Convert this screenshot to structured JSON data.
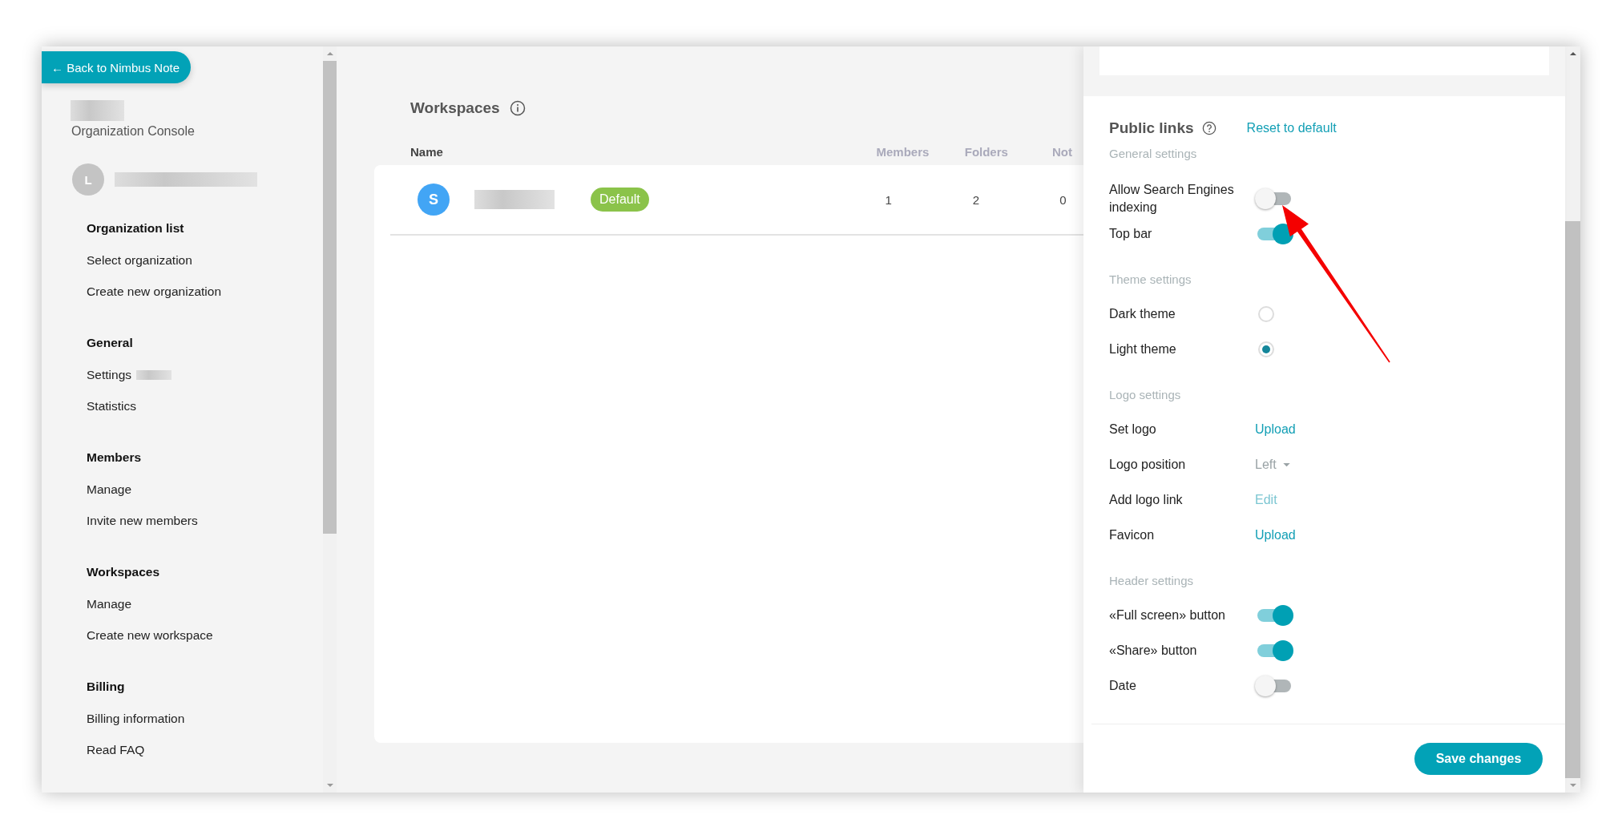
{
  "back_button": "← Back to Nimbus Note",
  "sidebar": {
    "subtitle": "Organization Console",
    "avatar_letter": "L",
    "sections": [
      {
        "title": "Organization list",
        "items": [
          {
            "label": "Select organization",
            "redacted": false
          },
          {
            "label": "Create new organization",
            "redacted": false
          }
        ]
      },
      {
        "title": "General",
        "items": [
          {
            "label": "Settings",
            "redacted": true
          },
          {
            "label": "Statistics",
            "redacted": false
          }
        ]
      },
      {
        "title": "Members",
        "items": [
          {
            "label": "Manage",
            "redacted": false
          },
          {
            "label": "Invite new members",
            "redacted": false
          }
        ]
      },
      {
        "title": "Workspaces",
        "items": [
          {
            "label": "Manage",
            "redacted": false
          },
          {
            "label": "Create new workspace",
            "redacted": false
          }
        ]
      },
      {
        "title": "Billing",
        "items": [
          {
            "label": "Billing information",
            "redacted": false
          },
          {
            "label": "Read FAQ",
            "redacted": false
          }
        ]
      }
    ]
  },
  "main": {
    "title": "Workspaces",
    "columns": [
      "Name",
      "Members",
      "Folders",
      "Not"
    ],
    "rows": [
      {
        "initial": "S",
        "badge": "Default",
        "members": "1",
        "folders": "2",
        "column_4": "0"
      }
    ]
  },
  "panel": {
    "title": "Public links",
    "reset_link": "Reset to default",
    "groups": [
      {
        "heading": "General settings",
        "rows": [
          {
            "kind": "toggle",
            "label": "Allow Search Engines indexing",
            "on": false
          },
          {
            "kind": "toggle",
            "label": "Top bar",
            "on": true
          }
        ]
      },
      {
        "heading": "Theme settings",
        "rows": [
          {
            "kind": "radio",
            "label": "Dark theme",
            "selected": false
          },
          {
            "kind": "radio",
            "label": "Light theme",
            "selected": true
          }
        ]
      },
      {
        "heading": "Logo settings",
        "rows": [
          {
            "kind": "link",
            "label": "Set logo",
            "value": "Upload",
            "disabled": false
          },
          {
            "kind": "dropdown",
            "label": "Logo position",
            "value": "Left",
            "disabled": true
          },
          {
            "kind": "link",
            "label": "Add logo link",
            "value": "Edit",
            "disabled": true
          },
          {
            "kind": "link",
            "label": "Favicon",
            "value": "Upload",
            "disabled": false
          }
        ]
      },
      {
        "heading": "Header settings",
        "rows": [
          {
            "kind": "toggle",
            "label": "«Full screen» button",
            "on": true
          },
          {
            "kind": "toggle",
            "label": "«Share» button",
            "on": true
          },
          {
            "kind": "toggle",
            "label": "Date",
            "on": false
          }
        ]
      }
    ]
  },
  "save_button": "Save changes"
}
